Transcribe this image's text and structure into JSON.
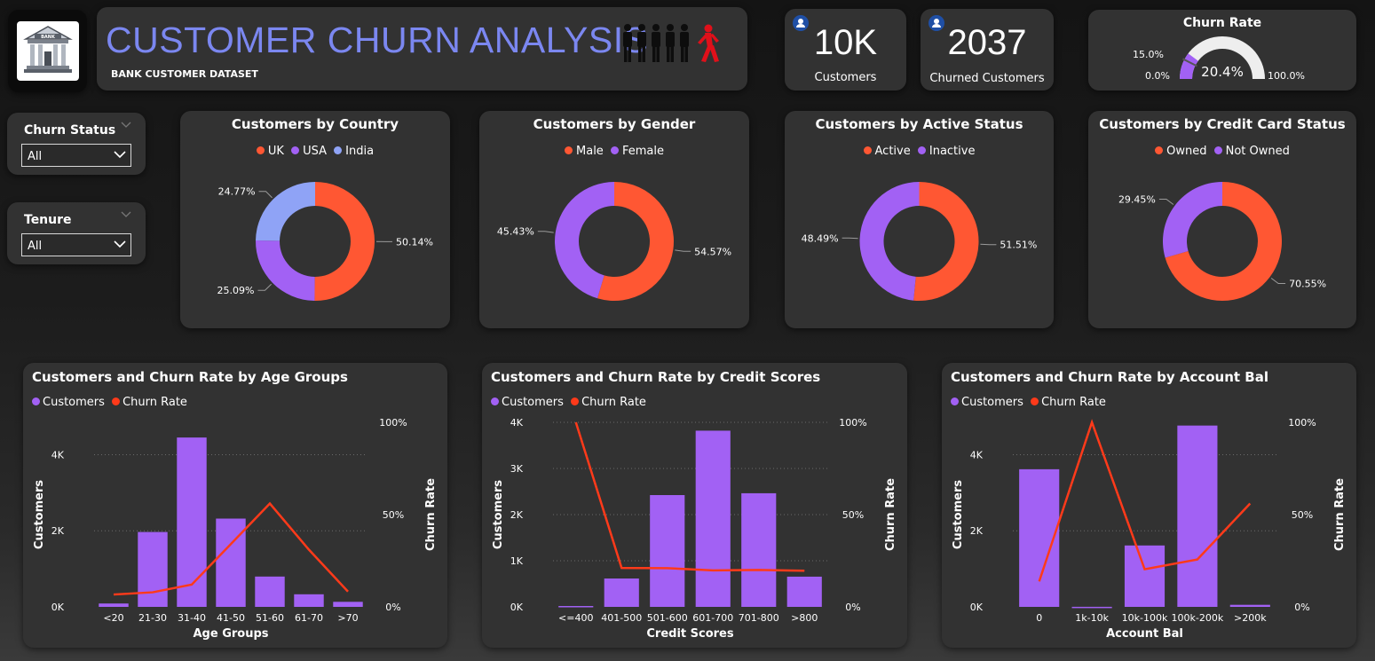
{
  "header": {
    "title": "CUSTOMER CHURN ANALYSIS",
    "subtitle": "BANK CUSTOMER DATASET",
    "logo_text": "BANK",
    "logo_icon": "bank-building-icon",
    "people_icon": "people-walking-away-icon"
  },
  "kpis": {
    "customers_value": "10K",
    "customers_label": "Customers",
    "churned_value": "2037",
    "churned_label": "Churned Customers",
    "icon": "user-icon"
  },
  "gauge": {
    "title": "Churn Rate",
    "value": 20.4,
    "value_label": "20.4%",
    "target_label": "15.0%",
    "min_label": "0.0%",
    "max_label": "100.0%",
    "target": 15.0,
    "min": 0,
    "max": 100
  },
  "filters": [
    {
      "label": "Churn Status",
      "value": "All"
    },
    {
      "label": "Tenure",
      "value": "All"
    }
  ],
  "colors": {
    "orange": "#ff5733",
    "purple": "#a261f4",
    "blue": "#8fa3f6",
    "line_red": "#ff3a1a",
    "title_blue": "#7b87f0"
  },
  "donuts": [
    {
      "title": "Customers by Country",
      "slices": [
        {
          "name": "UK",
          "value": 50.14,
          "label": "50.14%",
          "color": "#ff5733"
        },
        {
          "name": "USA",
          "value": 25.09,
          "label": "25.09%",
          "color": "#a261f4"
        },
        {
          "name": "India",
          "value": 24.77,
          "label": "24.77%",
          "color": "#8fa3f6"
        }
      ]
    },
    {
      "title": "Customers by Gender",
      "slices": [
        {
          "name": "Male",
          "value": 54.57,
          "label": "54.57%",
          "color": "#ff5733"
        },
        {
          "name": "Female",
          "value": 45.43,
          "label": "45.43%",
          "color": "#a261f4"
        }
      ]
    },
    {
      "title": "Customers by Active Status",
      "slices": [
        {
          "name": "Active",
          "value": 51.51,
          "label": "51.51%",
          "color": "#ff5733"
        },
        {
          "name": "Inactive",
          "value": 48.49,
          "label": "48.49%",
          "color": "#a261f4"
        }
      ]
    },
    {
      "title": "Customers by Credit Card Status",
      "slices": [
        {
          "name": "Owned",
          "value": 70.55,
          "label": "70.55%",
          "color": "#ff5733"
        },
        {
          "name": "Not Owned",
          "value": 29.45,
          "label": "29.45%",
          "color": "#a261f4"
        }
      ]
    }
  ],
  "combo_legend": {
    "bar": "Customers",
    "line": "Churn Rate"
  },
  "chart_data": [
    {
      "type": "bar",
      "title": "Customers and Churn Rate by Age Groups",
      "xlabel": "Age Groups",
      "ylabel": "Customers",
      "y2label": "Churn Rate",
      "categories": [
        "<20",
        "21-30",
        "31-40",
        "41-50",
        "51-60",
        "61-70",
        ">70"
      ],
      "yticks": [
        0,
        2000,
        4000
      ],
      "ytick_labels": [
        "0K",
        "2K",
        "4K"
      ],
      "ylim": [
        0,
        4850
      ],
      "y2ticks": [
        0,
        50,
        100
      ],
      "y2tick_labels": [
        "0%",
        "50%",
        "100%"
      ],
      "y2lim": [
        0,
        100
      ],
      "series": [
        {
          "name": "Customers",
          "kind": "bar",
          "values": [
            89,
            1968,
            4451,
            2320,
            797,
            331,
            133
          ]
        },
        {
          "name": "Churn Rate",
          "kind": "line",
          "axis": "right",
          "values": [
            6.7,
            7.9,
            12.1,
            34,
            56,
            31,
            8.3
          ]
        }
      ]
    },
    {
      "type": "bar",
      "title": "Customers and Churn Rate by Credit Scores",
      "xlabel": "Credit Scores",
      "ylabel": "Customers",
      "y2label": "Churn Rate",
      "categories": [
        "<=400",
        "401-500",
        "501-600",
        "601-700",
        "701-800",
        ">800"
      ],
      "yticks": [
        0,
        1000,
        2000,
        3000,
        4000
      ],
      "ytick_labels": [
        "0K",
        "1K",
        "2K",
        "3K",
        "4K"
      ],
      "ylim": [
        0,
        4000
      ],
      "y2ticks": [
        0,
        50,
        100
      ],
      "y2tick_labels": [
        "0%",
        "50%",
        "100%"
      ],
      "y2lim": [
        0,
        100
      ],
      "series": [
        {
          "name": "Customers",
          "kind": "bar",
          "values": [
            19,
            615,
            2423,
            3819,
            2463,
            655
          ]
        },
        {
          "name": "Churn Rate",
          "kind": "line",
          "axis": "right",
          "values": [
            100,
            21.1,
            21.0,
            19.8,
            20.0,
            19.6
          ]
        }
      ]
    },
    {
      "type": "bar",
      "title": "Customers and Churn Rate by Account Bal",
      "xlabel": "Account Bal",
      "ylabel": "Customers",
      "y2label": "Churn Rate",
      "categories": [
        "0",
        "1k-10k",
        "10k-100k",
        "100k-200k",
        ">200k"
      ],
      "yticks": [
        0,
        2000,
        4000
      ],
      "ytick_labels": [
        "0K",
        "2K",
        "4K"
      ],
      "ylim": [
        0,
        4850
      ],
      "y2ticks": [
        0,
        50,
        100
      ],
      "y2tick_labels": [
        "0%",
        "50%",
        "100%"
      ],
      "y2lim": [
        0,
        100
      ],
      "series": [
        {
          "name": "Customers",
          "kind": "bar",
          "values": [
            3617,
            2,
            1614,
            4765,
            54
          ]
        },
        {
          "name": "Churn Rate",
          "kind": "line",
          "axis": "right",
          "values": [
            13.8,
            100,
            20.4,
            25.7,
            56
          ]
        }
      ]
    }
  ]
}
